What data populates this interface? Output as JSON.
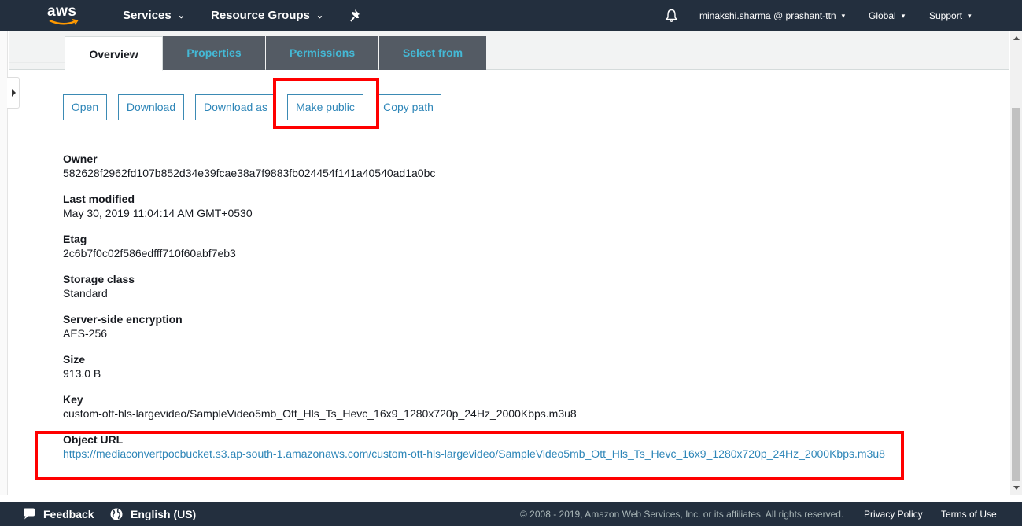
{
  "topnav": {
    "logo_text": "aws",
    "services": "Services",
    "resource_groups": "Resource Groups",
    "account": "minakshi.sharma @ prashant-ttn",
    "region": "Global",
    "support": "Support",
    "caret": "▾"
  },
  "tabs": [
    {
      "label": "Overview",
      "active": true
    },
    {
      "label": "Properties",
      "active": false
    },
    {
      "label": "Permissions",
      "active": false
    },
    {
      "label": "Select from",
      "active": false
    }
  ],
  "actions": {
    "open": "Open",
    "download": "Download",
    "download_as": "Download as",
    "make_public": "Make public",
    "copy_path": "Copy path"
  },
  "properties": [
    {
      "label": "Owner",
      "value": "582628f2962fd107b852d34e39fcae38a7f9883fb024454f141a40540ad1a0bc"
    },
    {
      "label": "Last modified",
      "value": "May 30, 2019 11:04:14 AM GMT+0530"
    },
    {
      "label": "Etag",
      "value": "2c6b7f0c02f586edfff710f60abf7eb3"
    },
    {
      "label": "Storage class",
      "value": "Standard"
    },
    {
      "label": "Server-side encryption",
      "value": "AES-256"
    },
    {
      "label": "Size",
      "value": "913.0 B"
    },
    {
      "label": "Key",
      "value": "custom-ott-hls-largevideo/SampleVideo5mb_Ott_Hls_Ts_Hevc_16x9_1280x720p_24Hz_2000Kbps.m3u8"
    },
    {
      "label": "Object URL",
      "value": "https://mediaconvertpocbucket.s3.ap-south-1.amazonaws.com/custom-ott-hls-largevideo/SampleVideo5mb_Ott_Hls_Ts_Hevc_16x9_1280x720p_24Hz_2000Kbps.m3u8"
    }
  ],
  "footer": {
    "feedback": "Feedback",
    "language": "English (US)",
    "copyright": "© 2008 - 2019, Amazon Web Services, Inc. or its affiliates. All rights reserved.",
    "privacy": "Privacy Policy",
    "terms": "Terms of Use"
  },
  "colors": {
    "nav_bg": "#232f3e",
    "link": "#2e86b8",
    "tab_inactive_bg": "#545b64",
    "tab_inactive_text": "#44b9d6",
    "annotation": "#ff0000"
  }
}
